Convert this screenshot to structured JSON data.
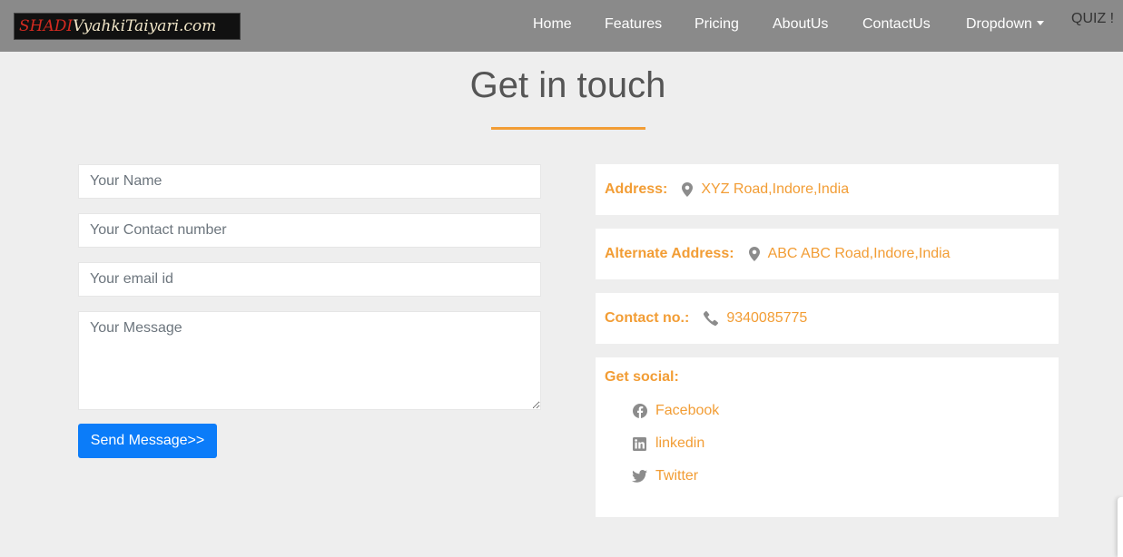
{
  "navbar": {
    "logo_part1": "SHADI",
    "logo_part2": "VyahkiTaiyari.com",
    "links": [
      "Home",
      "Features",
      "Pricing",
      "AboutUs",
      "ContactUs",
      "Dropdown"
    ],
    "quiz": "QUIZ !"
  },
  "heading": "Get in touch",
  "form": {
    "name_placeholder": "Your Name",
    "contact_placeholder": "Your Contact number",
    "email_placeholder": "Your email id",
    "message_placeholder": "Your Message",
    "send_label": "Send Message>>"
  },
  "info": {
    "address_label": "Address:",
    "address_value": "XYZ Road,Indore,India",
    "alt_address_label": "Alternate Address:",
    "alt_address_value": "ABC ABC Road,Indore,India",
    "contact_label": "Contact no.:",
    "contact_value": "9340085775",
    "social_label": "Get social:",
    "social_links": [
      "Facebook",
      "linkedin",
      "Twitter"
    ]
  },
  "colors": {
    "accent": "#f29d35",
    "primary_button": "#0b7cf9",
    "navbar": "#8a8a8a",
    "background": "#eeeeee"
  }
}
